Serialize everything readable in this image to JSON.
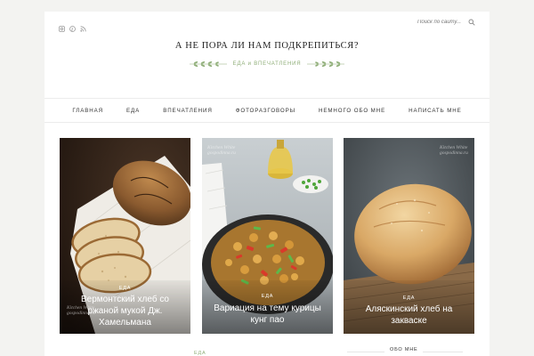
{
  "social": {
    "icons": [
      "instagram-icon",
      "pinterest-icon",
      "rss-icon"
    ]
  },
  "search": {
    "placeholder": "Поиск по сайту..."
  },
  "site": {
    "title": "А НЕ ПОРА ЛИ НАМ ПОДКРЕПИТЬСЯ?",
    "tagline": "ЕДА и ВПЕЧАТЛЕНИЯ"
  },
  "nav": {
    "items": [
      "ГЛАВНАЯ",
      "ЕДА",
      "ВПЕЧАТЛЕНИЯ",
      "ФОТОРАЗГОВОРЫ",
      "НЕМНОГО ОБО МНЕ",
      "НАПИСАТЬ МНЕ"
    ]
  },
  "posts": [
    {
      "category": "ЕДА",
      "title": "Вермонтский хлеб со ржаной мукой Дж. Хамельмана",
      "watermark": "Kitchen White\ngospodinna.ru"
    },
    {
      "category": "ЕДА",
      "title": "Вариация на тему курицы кунг пао",
      "watermark": "Kitchen White\ngospodinna.ru"
    },
    {
      "category": "ЕДА",
      "title": "Аляскинский хлеб на закваске",
      "watermark": "Kitchen White\ngospodinna.ru"
    }
  ],
  "bottom": {
    "category": "ЕДА",
    "about_label": "ОБО МНЕ"
  },
  "colors": {
    "accent": "#8fae78",
    "background": "#f3f3f1"
  }
}
